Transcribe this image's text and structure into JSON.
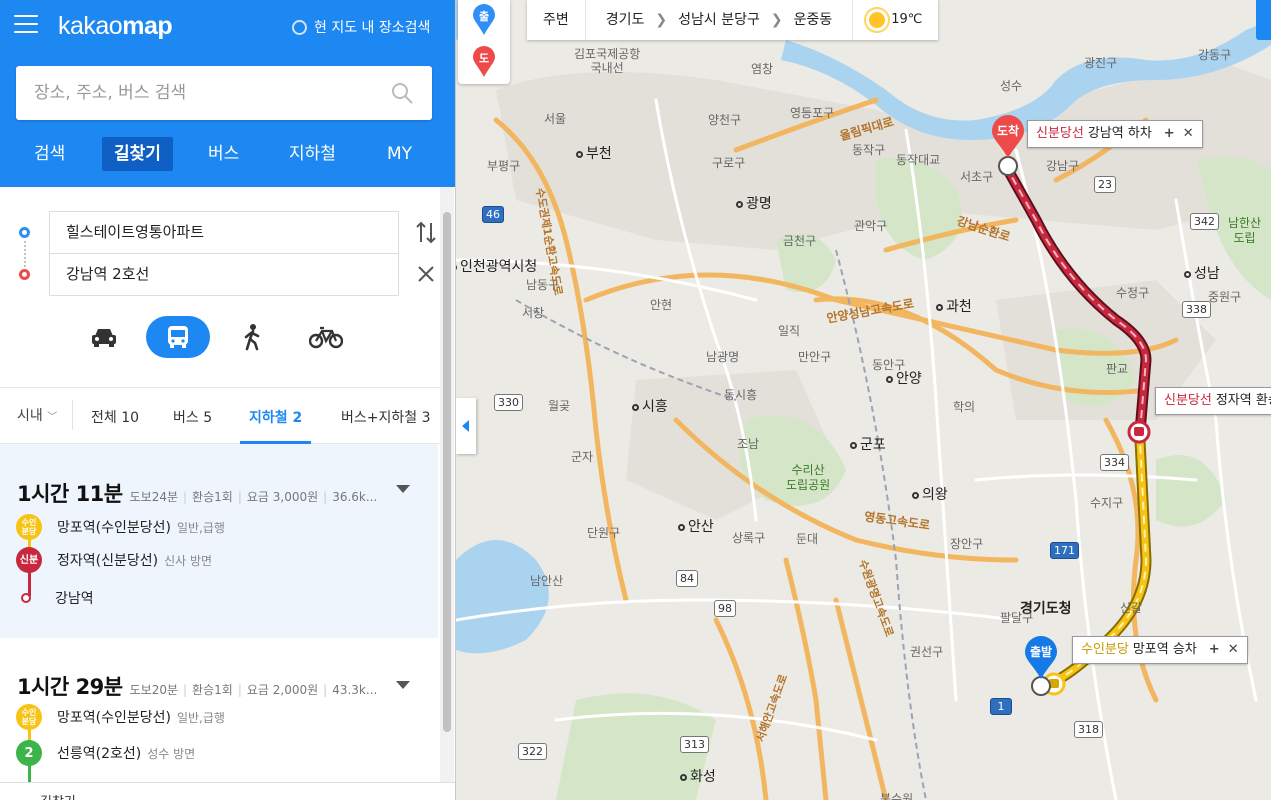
{
  "app": {
    "logo_plain": "kakao",
    "logo_bold": "map",
    "area_search": "현 지도 내 장소검색"
  },
  "search": {
    "placeholder": "장소, 주소, 버스 검색"
  },
  "main_tabs": [
    "검색",
    "길찾기",
    "버스",
    "지하철",
    "MY"
  ],
  "route": {
    "origin": "힐스테이트영통아파트",
    "destination": "강남역 2호선"
  },
  "filters": {
    "city": "시내",
    "tabs": [
      "전체 10",
      "버스 5",
      "지하철 2",
      "버스+지하철 3"
    ]
  },
  "results": [
    {
      "time": "1시간 11분",
      "walk": "도보24분",
      "transfer": "환승1회",
      "fare": "요금 3,000원",
      "distance": "36.6k...",
      "stops": [
        {
          "badge": "수인\n분당",
          "name": "망포역(수인분당선)",
          "sub": "일반,급행"
        },
        {
          "badge": "신분",
          "name": "정자역(신분당선)",
          "sub": "신사 방면"
        },
        {
          "badge": "",
          "name": "강남역",
          "sub": ""
        }
      ]
    },
    {
      "time": "1시간 29분",
      "walk": "도보20분",
      "transfer": "환승1회",
      "fare": "요금 2,000원",
      "distance": "43.3k...",
      "stops": [
        {
          "badge": "수인\n분당",
          "name": "망포역(수인분당선)",
          "sub": "일반,급행"
        },
        {
          "badge": "2",
          "name": "선릉역(2호선)",
          "sub": "성수 방면"
        }
      ]
    }
  ],
  "bottom_bar": [
    "길찾기 ..."
  ],
  "map": {
    "location_bar": {
      "nearby": "주변",
      "region": [
        "경기도",
        "성남시 분당구",
        "운중동"
      ],
      "temperature": "19℃"
    },
    "marker_start": "출",
    "marker_end": "도",
    "pin_start": "출발",
    "pin_end": "도착",
    "callouts": {
      "arrival": {
        "line": "신분당선",
        "text": "강남역 하차"
      },
      "transfer": {
        "line": "신분당선",
        "text": "정자역 환승"
      },
      "departure": {
        "line": "수인분당",
        "text": "망포역 승차"
      }
    },
    "places": [
      "김포국제공항\n국내선",
      "서울",
      "부천",
      "부평구",
      "광명",
      "양천구",
      "영등포구",
      "구로구",
      "동작구",
      "동작대교",
      "금천구",
      "관악구",
      "서초구",
      "강남구",
      "성수",
      "광진구",
      "강동구",
      "과천",
      "성남",
      "중원구",
      "안양",
      "동안구",
      "만안구",
      "안현",
      "서창",
      "남동구",
      "시흥",
      "월곶",
      "군포",
      "의왕",
      "학의",
      "수리산\n도립공원",
      "안산",
      "단원구",
      "상록구",
      "남안산",
      "경기도청",
      "팔달구",
      "권선구",
      "화성",
      "판교",
      "수정구",
      "수지구",
      "장안구",
      "인천광역시청",
      "조남",
      "동시흥",
      "일직",
      "둔대",
      "군자",
      "남한산\n도립",
      "염창",
      "올림픽대로",
      "강남순환로",
      "수도권제1순환고속도로",
      "안양성남고속도로",
      "영동고속도로",
      "서해안고속도로",
      "수원광명고속도로",
      "남광명",
      "신갈",
      "북수원"
    ],
    "road_numbers": [
      "46",
      "330",
      "84",
      "98",
      "313",
      "322",
      "171",
      "334",
      "338",
      "342",
      "23",
      "318",
      "1"
    ]
  }
}
